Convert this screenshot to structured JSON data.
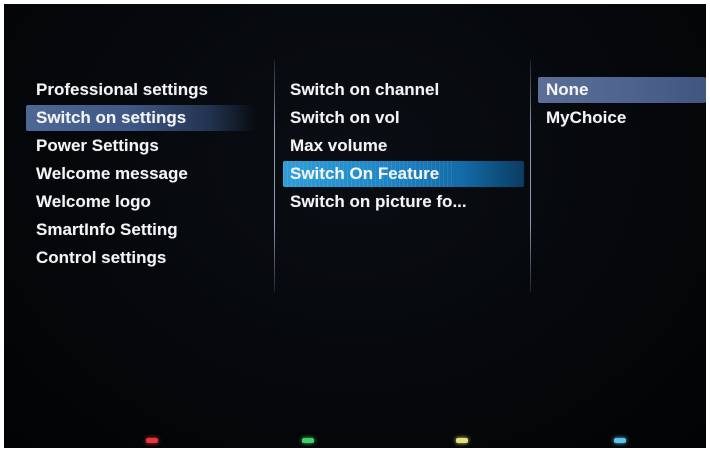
{
  "menu_level1": {
    "items": [
      {
        "label": "Professional settings"
      },
      {
        "label": "Switch on settings"
      },
      {
        "label": "Power Settings"
      },
      {
        "label": "Welcome message"
      },
      {
        "label": "Welcome logo"
      },
      {
        "label": "SmartInfo Setting"
      },
      {
        "label": "Control settings"
      }
    ],
    "selected_index": 1
  },
  "menu_level2": {
    "items": [
      {
        "label": "Switch on channel"
      },
      {
        "label": "Switch on vol"
      },
      {
        "label": "Max volume"
      },
      {
        "label": "Switch On Feature"
      },
      {
        "label": "Switch on picture fo..."
      }
    ],
    "focused_index": 3
  },
  "menu_level3": {
    "items": [
      {
        "label": "None"
      },
      {
        "label": "MyChoice"
      }
    ],
    "selected_index": 0
  },
  "color_keys": {
    "red": "#e8343e",
    "green": "#3fd26a",
    "yellow": "#e6e07a",
    "blue": "#5cc4e8"
  },
  "colors": {
    "highlight_parent": "#4a6290",
    "highlight_focus": "#1f88c8",
    "highlight_value": "#56698f"
  }
}
